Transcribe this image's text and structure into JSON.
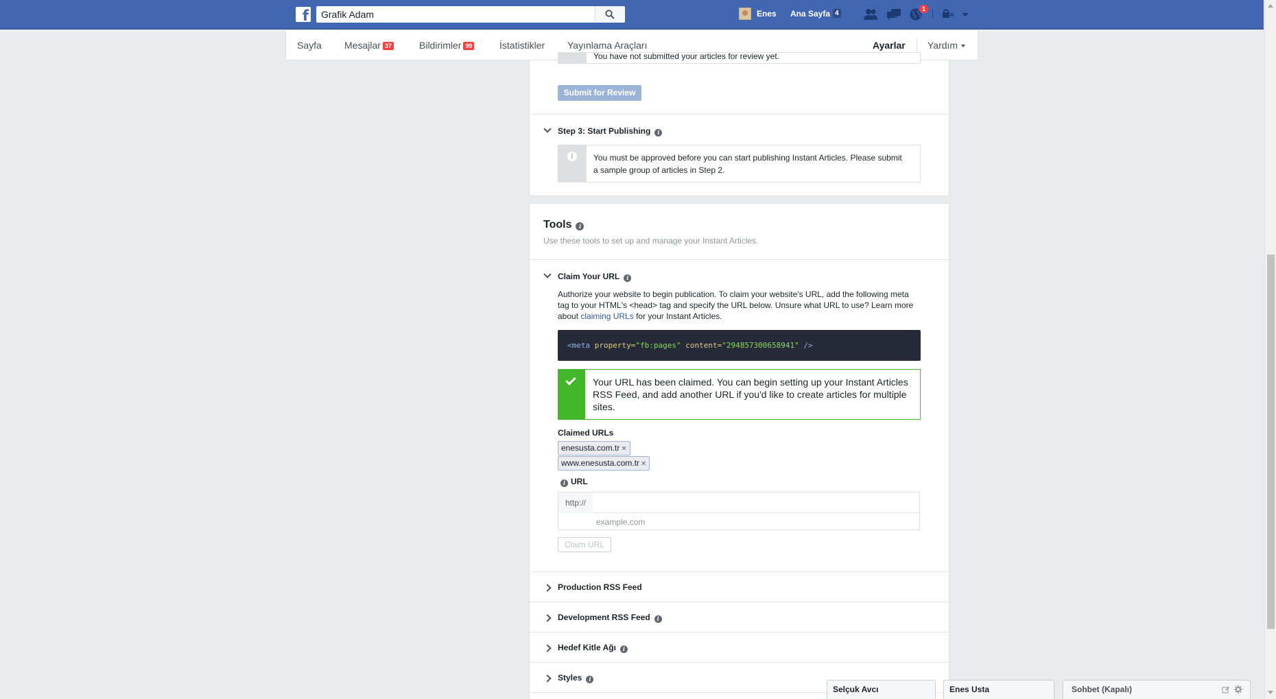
{
  "topbar": {
    "search_value": "Grafik Adam",
    "user_name": "Enes",
    "home_label": "Ana Sayfa",
    "home_count": "4",
    "notification_count": "1"
  },
  "page_nav": {
    "items": [
      {
        "label": "Sayfa"
      },
      {
        "label": "Mesajlar",
        "badge": "37"
      },
      {
        "label": "Bildirimler",
        "badge": "99"
      },
      {
        "label": "İstatistikler"
      },
      {
        "label": "Yayınlama Araçları"
      }
    ],
    "settings_label": "Ayarlar",
    "help_label": "Yardım"
  },
  "step2": {
    "partial_text": "You have not submitted your articles for review yet.",
    "button_label": "Submit for Review"
  },
  "step3": {
    "title": "Step 3: Start Publishing",
    "info_line1": "You must be approved before you can start publishing Instant Articles. Please submit",
    "info_line2": "a sample group of articles in Step 2."
  },
  "tools": {
    "title": "Tools",
    "description": "Use these tools to set up and manage your Instant Articles.",
    "claim": {
      "title": "Claim Your URL",
      "para_line1": "Authorize your website to begin publication. To claim your website's URL, add the following meta",
      "para_line2": "tag to your HTML's <head> tag and specify the URL below. Unsure what URL to use? Learn more",
      "para_about": "about ",
      "para_link": "claiming URLs",
      "para_end": " for your Instant Articles.",
      "code": {
        "open": "<meta ",
        "attr1": "property=",
        "val1": "\"fb:pages\"",
        "attr2": " content=",
        "val2": "\"294857300658941\"",
        "close": " />"
      },
      "success_text": "Your URL has been claimed. You can begin setting up your Instant Articles RSS Feed, and add another URL if you'd like to create articles for multiple sites.",
      "claimed_label": "Claimed URLs",
      "claimed_urls": [
        "enesusta.com.tr",
        "www.enesusta.com.tr"
      ],
      "url_label": "URL",
      "url_prefix": "http://",
      "url_value": "",
      "url_hint": "example.com",
      "button_label": "Claim URL"
    },
    "sections": [
      {
        "title": "Production RSS Feed"
      },
      {
        "title": "Development RSS Feed"
      },
      {
        "title": "Hedef Kitle Ağı"
      },
      {
        "title": "Styles"
      }
    ]
  },
  "chat": {
    "tabs": [
      "Selçuk Avcı",
      "Enes Usta"
    ],
    "status_label": "Sohbet (Kapalı)"
  },
  "colors": {
    "brand": "#4267b2",
    "success": "#42b72a",
    "badge": "#fa3e3e"
  }
}
